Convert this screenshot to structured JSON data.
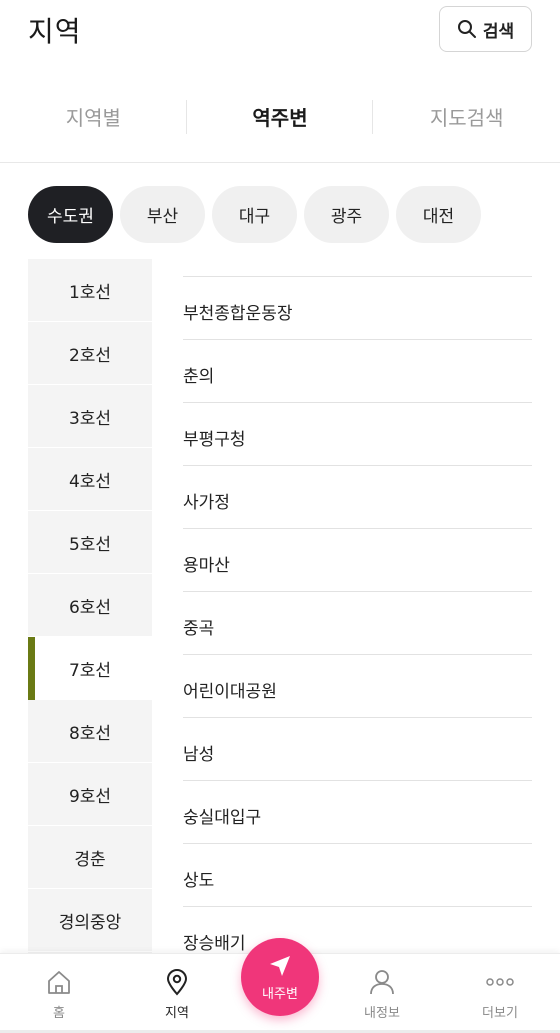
{
  "header": {
    "title": "지역",
    "search_label": "검색"
  },
  "tabs": [
    {
      "label": "지역별",
      "active": false
    },
    {
      "label": "역주변",
      "active": true
    },
    {
      "label": "지도검색",
      "active": false
    }
  ],
  "regions": [
    {
      "label": "수도권",
      "active": true
    },
    {
      "label": "부산",
      "active": false
    },
    {
      "label": "대구",
      "active": false
    },
    {
      "label": "광주",
      "active": false
    },
    {
      "label": "대전",
      "active": false
    }
  ],
  "lines": [
    {
      "label": "1호선"
    },
    {
      "label": "2호선"
    },
    {
      "label": "3호선"
    },
    {
      "label": "4호선"
    },
    {
      "label": "5호선"
    },
    {
      "label": "6호선"
    },
    {
      "label": "7호선",
      "active": true
    },
    {
      "label": "8호선"
    },
    {
      "label": "9호선"
    },
    {
      "label": "경춘"
    },
    {
      "label": "경의중앙"
    }
  ],
  "stations": [
    "부천종합운동장",
    "춘의",
    "부평구청",
    "사가정",
    "용마산",
    "중곡",
    "어린이대공원",
    "남성",
    "숭실대입구",
    "상도",
    "장승배기"
  ],
  "bottom_nav": {
    "home": "홈",
    "region": "지역",
    "nearby": "내주변",
    "my_info": "내정보",
    "more": "더보기"
  },
  "colors": {
    "accent_pink": "#f0367a",
    "active_line_bar": "#6a7a14",
    "chip_active_bg": "#1f2024"
  },
  "icons": {
    "search": "search-icon",
    "home": "home-icon",
    "region": "location-pin-icon",
    "nearby": "navigation-arrow-icon",
    "my_info": "person-icon",
    "more": "more-dots-icon"
  }
}
